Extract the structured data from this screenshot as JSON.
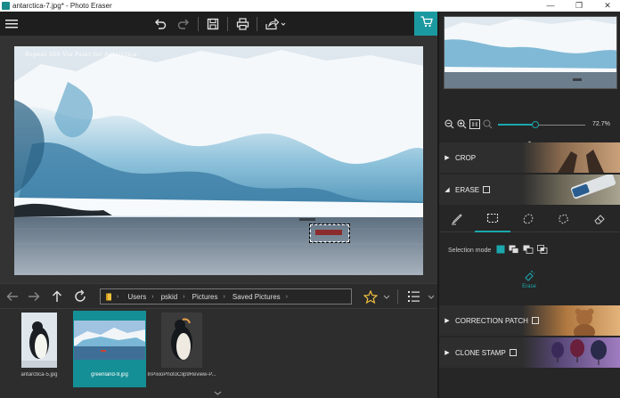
{
  "window": {
    "title": "antarctica-7.jpg* - Photo Eraser",
    "controls": [
      "—",
      "❐",
      "✕"
    ]
  },
  "photo": {
    "watermark": "Repeat 360 Vin Paint for Antarctica"
  },
  "breadcrumb": {
    "items": [
      "Users",
      "pskid",
      "Pictures",
      "Saved Pictures"
    ]
  },
  "thumbnails": [
    {
      "caption": "antarctica-5.jpg",
      "selected": false
    },
    {
      "caption": "greenland-9.jpg",
      "selected": true
    },
    {
      "caption": "InPixioPhotoClip9Review-P...",
      "selected": false
    }
  ],
  "zoom": {
    "value_text": "72.7%",
    "level": 0.43
  },
  "panels": {
    "crop": "CROP",
    "erase": "ERASE",
    "correction_patch": "CORRECTION PATCH",
    "clone_stamp": "CLONE STAMP"
  },
  "erase_tools": {
    "selection_mode_label": "Selection mode",
    "erase_button_label": "Erase"
  },
  "colors": {
    "accent": "#1aa7ad",
    "toolbar": "#1e1e1e",
    "panel": "#262626"
  }
}
